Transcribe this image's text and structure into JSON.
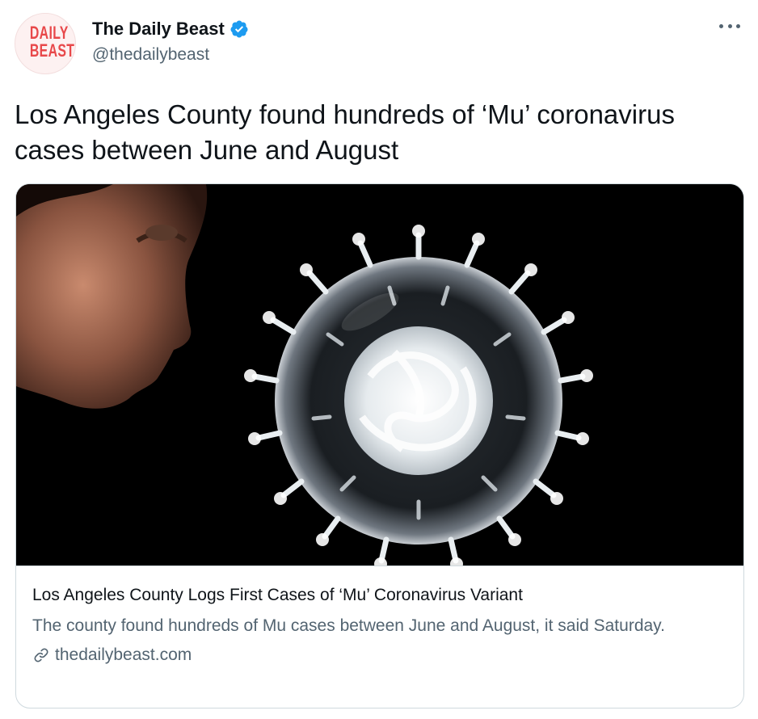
{
  "author": {
    "avatar_lines": [
      "DAILY",
      "BEAST"
    ],
    "display_name": "The Daily Beast",
    "handle": "@thedailybeast",
    "verified": true
  },
  "menu": {
    "icon": "more-horizontal-icon"
  },
  "tweet": {
    "text": "Los Angeles County found hundreds of ‘Mu’ coronavirus cases between June and August"
  },
  "card": {
    "title": "Los Angeles County Logs First Cases of ‘Mu’ Coronavirus Variant",
    "description": "The county found hundreds of Mu cases between June and August, it said Saturday.",
    "domain": "thedailybeast.com",
    "link_icon": "link-icon"
  },
  "colors": {
    "text_primary": "#0f1419",
    "text_secondary": "#536471",
    "verified_blue": "#1d9bf0",
    "brand_red": "#e8484a",
    "border": "#cfd9de"
  }
}
